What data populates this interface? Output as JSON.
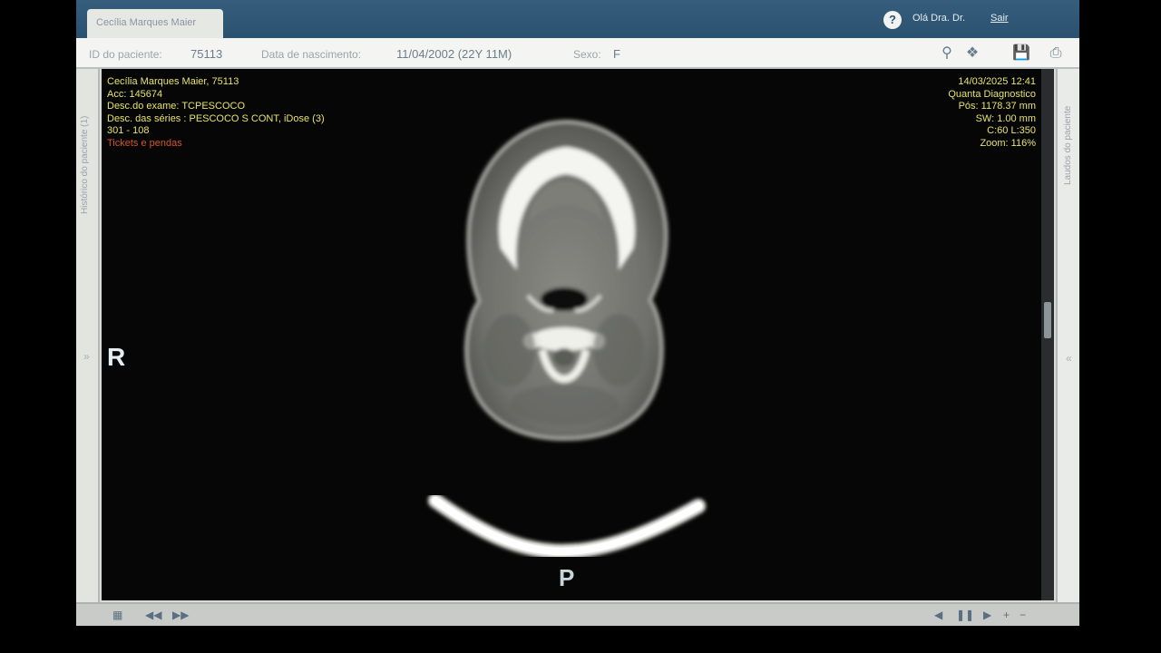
{
  "header": {
    "patient_tab": "Cecília Marques Maier",
    "help_icon": "?",
    "greeting": "Olá Dra. Dr.",
    "logout": "Sair"
  },
  "patient_info": {
    "id_label": "ID do paciente:",
    "id_value": "75113",
    "dob_label": "Data de nascimento:",
    "dob_value": "11/04/2002 (22Y 11M)",
    "sex_label": "Sexo:",
    "sex_value": "F"
  },
  "toolbar_icons": [
    "search-icon",
    "fit-icon",
    "save-icon",
    "print-icon"
  ],
  "sidebars": {
    "left_title": "Histórico do paciente (1)",
    "right_title": "Laudos do paciente"
  },
  "overlay_top_left": {
    "name": "Cecília Marques Maier, 75113",
    "acc": "Acc: 145674",
    "exam": "Desc.do exame: TCPESCOCO",
    "series": "Desc. das séries : PESCOCO S CONT, iDose (3)",
    "image": "301 - 108",
    "warning": "Tickets e pendas"
  },
  "overlay_top_right": {
    "datetime": "14/03/2025 12:41",
    "institution": "Quanta Diagnostico",
    "pos": "Pós: 1178.37 mm",
    "sw": "SW: 1.00 mm",
    "window": "C:60 L:350",
    "zoom": "Zoom: 116%"
  },
  "orientation": {
    "left": "R",
    "bottom": "P"
  },
  "scroll_position": 0.47
}
